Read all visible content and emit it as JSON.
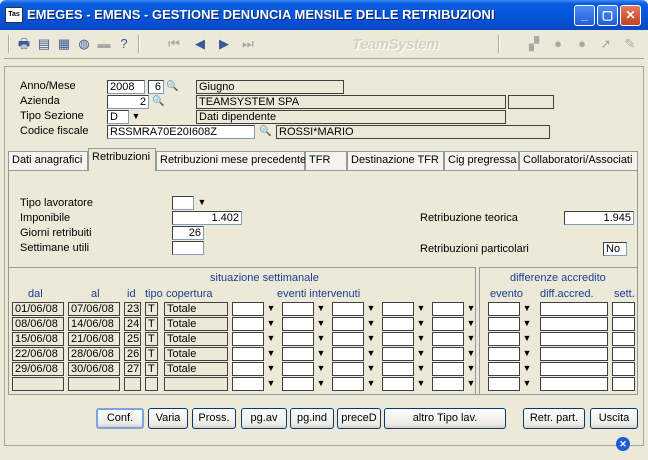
{
  "window": {
    "title": "EMEGES  - EMENS - GESTIONE DENUNCIA MENSILE DELLE RETRIBUZIONI",
    "logo": "Tas",
    "brand": "TeamSystem"
  },
  "header": {
    "anno_mese_label": "Anno/Mese",
    "anno": "2008",
    "mese": "6",
    "mese_desc": "Giugno",
    "azienda_label": "Azienda",
    "azienda": "2",
    "azienda_desc": "TEAMSYSTEM SPA",
    "tipo_sezione_label": "Tipo Sezione",
    "tipo_sezione": "D",
    "tipo_sezione_desc": "Dati dipendente",
    "codice_fiscale_label": "Codice fiscale",
    "codice_fiscale": "RSSMRA70E20I608Z",
    "nominativo": "ROSSI*MARIO"
  },
  "tabs": [
    {
      "label": "Dati anagrafici",
      "active": false
    },
    {
      "label": "Retribuzioni",
      "active": true
    },
    {
      "label": "Retribuzioni mese precedente",
      "active": false
    },
    {
      "label": "TFR",
      "active": false
    },
    {
      "label": "Destinazione TFR",
      "active": false
    },
    {
      "label": "Cig pregressa",
      "active": false
    },
    {
      "label": "Collaboratori/Associati",
      "active": false
    }
  ],
  "retribuzioni": {
    "tipo_lavoratore_label": "Tipo lavoratore",
    "tipo_lavoratore": "",
    "imponibile_label": "Imponibile",
    "imponibile": "1.402",
    "giorni_label": "Giorni retribuiti",
    "giorni": "26",
    "settimane_label": "Settimane utili",
    "settimane": "",
    "teorica_label": "Retribuzione teorica",
    "teorica": "1.945",
    "particolari_label": "Retribuzioni particolari",
    "particolari": "No"
  },
  "settimanale": {
    "title": "situazione settimanale",
    "col_dal": "dal",
    "col_al": "al",
    "col_id": "id",
    "col_tipo": "tipo",
    "col_copertura": "copertura",
    "col_eventi": "eventi intervenuti",
    "rows": [
      {
        "dal": "01/06/08",
        "al": "07/06/08",
        "id": "23",
        "tipo": "T",
        "copertura": "Totale"
      },
      {
        "dal": "08/06/08",
        "al": "14/06/08",
        "id": "24",
        "tipo": "T",
        "copertura": "Totale"
      },
      {
        "dal": "15/06/08",
        "al": "21/06/08",
        "id": "25",
        "tipo": "T",
        "copertura": "Totale"
      },
      {
        "dal": "22/06/08",
        "al": "28/06/08",
        "id": "26",
        "tipo": "T",
        "copertura": "Totale"
      },
      {
        "dal": "29/06/08",
        "al": "30/06/08",
        "id": "27",
        "tipo": "T",
        "copertura": "Totale"
      },
      {
        "dal": "",
        "al": "",
        "id": "",
        "tipo": "",
        "copertura": ""
      }
    ]
  },
  "differenze": {
    "title": "differenze accredito",
    "col_evento": "evento",
    "col_diff": "diff.accred.",
    "col_sett": "sett."
  },
  "buttons": {
    "conf": "Conf.",
    "varia": "Varia",
    "pross": "Pross.",
    "pgav": "pg.av",
    "pgind": "pg.ind",
    "preced": "preceD",
    "altro": "altro Tipo lav.",
    "retr_part": "Retr. part.",
    "uscita": "Uscita"
  },
  "icons": [
    "print-icon",
    "preview-icon",
    "export-icon",
    "globe-icon",
    "folder-icon",
    "help-icon",
    "first-icon",
    "prev-icon",
    "next-icon",
    "last-icon",
    "ts-icon-1",
    "ts-icon-2",
    "ts-icon-3",
    "ts-icon-4",
    "ts-icon-5"
  ]
}
